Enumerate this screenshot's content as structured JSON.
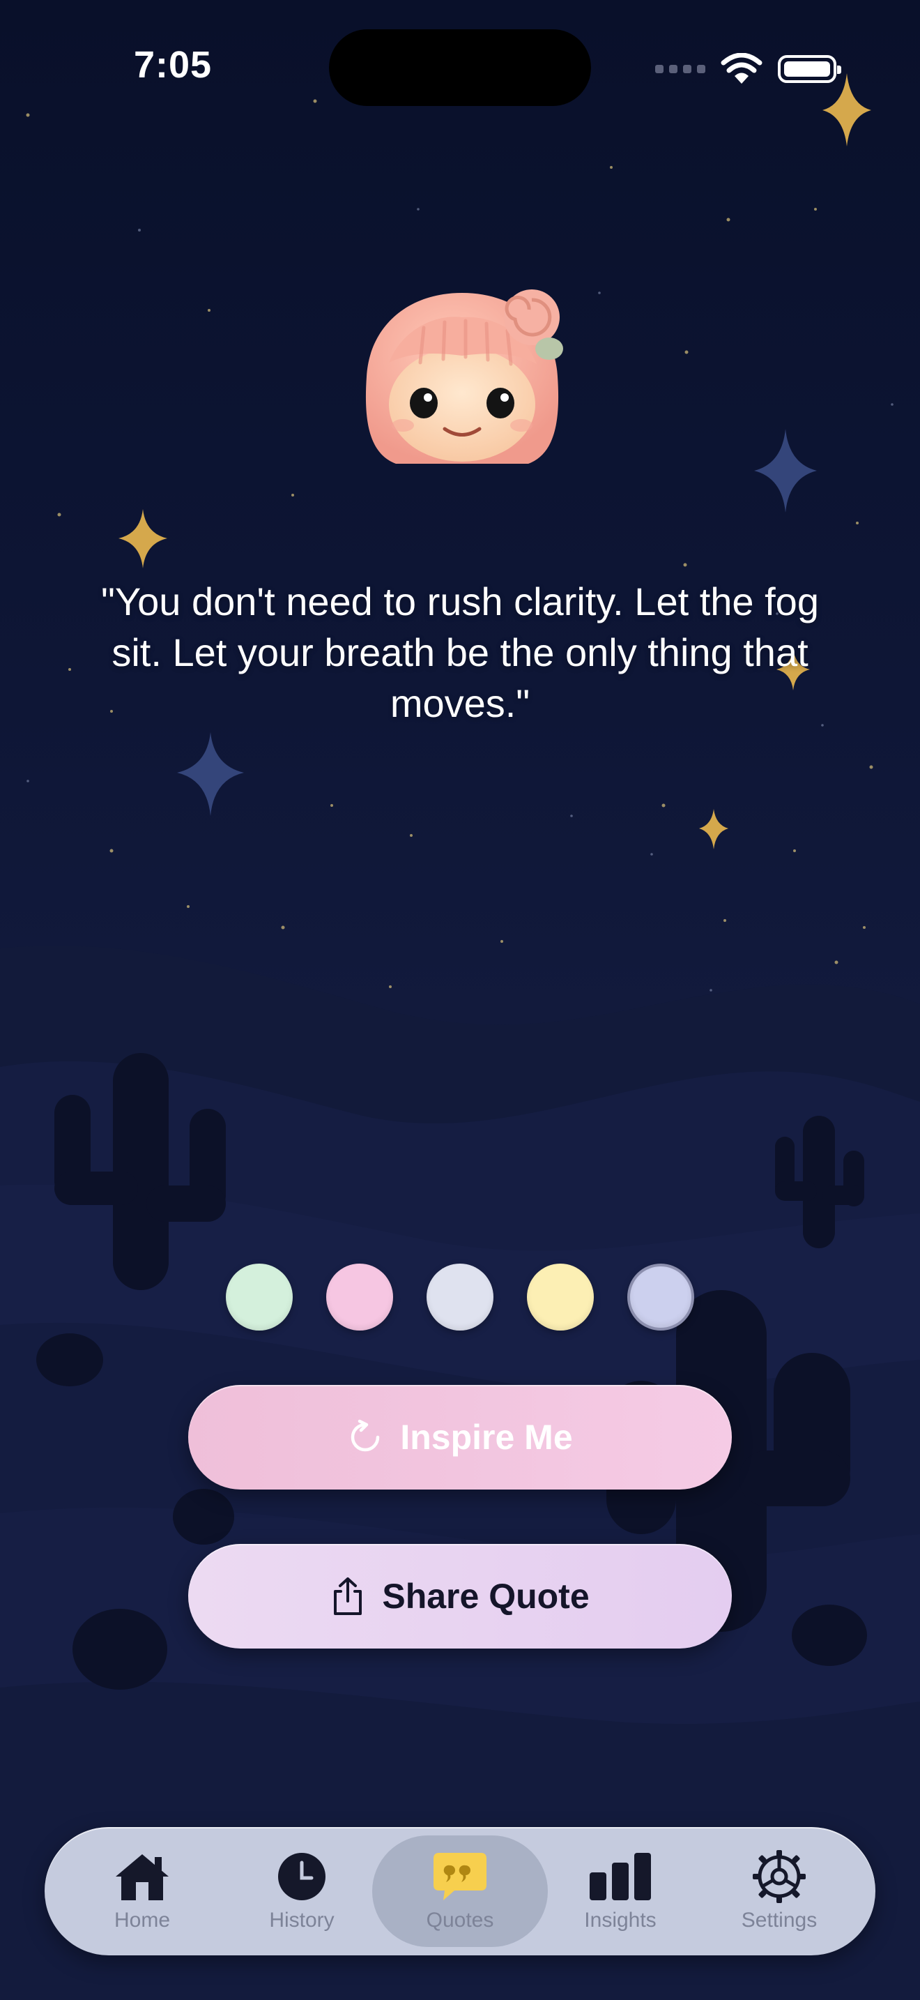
{
  "status_bar": {
    "time": "7:05"
  },
  "quote": {
    "text": "\"You don't need to rush clarity. Let the fog sit. Let your breath be the only thing that moves.\""
  },
  "palette": {
    "colors": [
      "#d4f0dc",
      "#f6c6e2",
      "#dfe2ef",
      "#fcefb4",
      "#ccd0ee"
    ],
    "selected_index": 4
  },
  "actions": {
    "inspire_label": "Inspire Me",
    "share_label": "Share Quote"
  },
  "tabbar": {
    "active": "quotes",
    "items": [
      {
        "id": "home",
        "label": "Home",
        "icon": "house-icon"
      },
      {
        "id": "history",
        "label": "History",
        "icon": "clock-icon"
      },
      {
        "id": "quotes",
        "label": "Quotes",
        "icon": "quote-bubble-icon"
      },
      {
        "id": "insights",
        "label": "Insights",
        "icon": "bar-chart-icon"
      },
      {
        "id": "settings",
        "label": "Settings",
        "icon": "gear-icon"
      }
    ]
  },
  "colors": {
    "accent_yellow": "#f7cf4e",
    "icon_dark": "#15182a",
    "tab_label": "#7d8398"
  }
}
